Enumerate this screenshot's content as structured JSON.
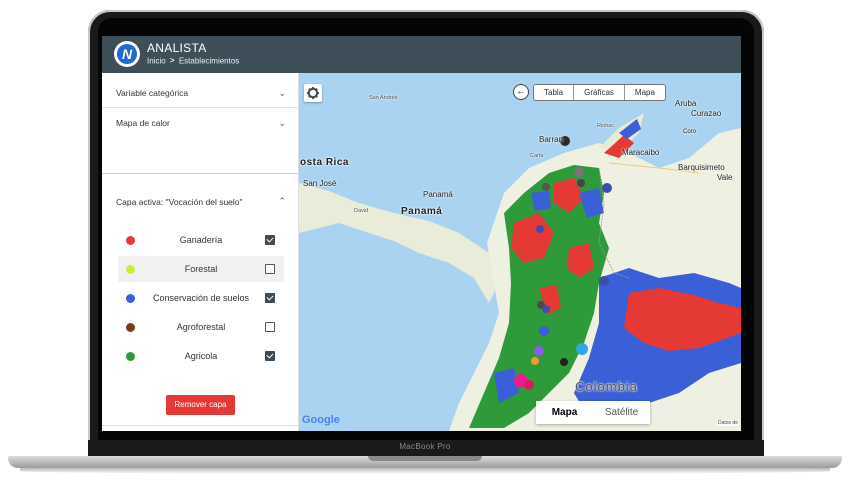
{
  "device": {
    "label": "MacBook Pro"
  },
  "header": {
    "title": "ANALISTA",
    "logo_letter": "N",
    "breadcrumb": {
      "home": "Inicio",
      "separator": ">",
      "current": "Establecimientos"
    }
  },
  "sidebar": {
    "sections": [
      {
        "label": "Variable categórica",
        "chevron": "chevron-down-icon"
      },
      {
        "label": "Mapa de calor",
        "chevron": "chevron-down-icon"
      },
      {
        "label": "Capa activa: \"Vocación del suelo\"",
        "chevron": "chevron-up-icon"
      }
    ],
    "layers": [
      {
        "label": "Ganadería",
        "color": "#e53935",
        "checked": true
      },
      {
        "label": "Forestal",
        "color": "#c6ef3a",
        "checked": false
      },
      {
        "label": "Conservación de suelos",
        "color": "#3a5fd6",
        "checked": true
      },
      {
        "label": "Agroforestal",
        "color": "#7b3b1e",
        "checked": false
      },
      {
        "label": "Agricola",
        "color": "#2e9a3a",
        "checked": true
      }
    ],
    "remove_button": "Remover capa"
  },
  "map": {
    "view_toggle": [
      "Tabla",
      "Gráficas",
      "Mapa"
    ],
    "map_type": {
      "map": "Mapa",
      "satellite": "Satélite"
    },
    "provider": "Google",
    "credit": "Datos de",
    "labels": {
      "aruba": "Aruba",
      "curazao": "Curazao",
      "coro": "Coro",
      "barranquilla": "Barran",
      "maracaibo": "Maracaibo",
      "barquisimeto": "Barquisimeto",
      "valencia": "Vale",
      "costa_rica": "osta Rica",
      "san_jose": "San José",
      "panama_city": "Panamá",
      "panama": "Panamá",
      "david": "David",
      "san_andres": "San Andrés",
      "colombia": "Colombia",
      "riohacha": "Riohac",
      "cartagena": "Carta"
    }
  }
}
